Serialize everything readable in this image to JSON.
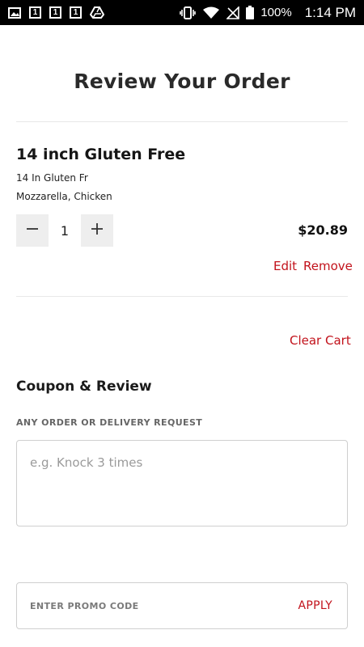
{
  "status_bar": {
    "icons": [
      "image-icon",
      "sim-1-icon",
      "sim-1-icon",
      "sim-1-icon",
      "drive-icon",
      "vibrate-icon",
      "wifi-icon",
      "no-signal-icon",
      "battery-icon"
    ],
    "sim_label": "1",
    "battery": "100%",
    "time": "1:14 PM"
  },
  "page": {
    "title": "Review Your Order"
  },
  "cart_item": {
    "name": "14 inch Gluten Free",
    "size_line": "14 In Gluten Fr",
    "toppings_line": "Mozzarella, Chicken",
    "quantity": "1",
    "price": "$20.89",
    "edit_label": "Edit",
    "remove_label": "Remove",
    "minus_icon": "minus-icon",
    "plus_icon": "plus-icon"
  },
  "clear_cart_label": "Clear Cart",
  "coupon_section": {
    "title": "Coupon & Review",
    "request_label": "ANY ORDER OR DELIVERY REQUEST",
    "request_value": "",
    "request_placeholder": "e.g. Knock 3 times",
    "promo_value": "",
    "promo_placeholder": "ENTER PROMO CODE",
    "apply_label": "APPLY"
  },
  "colors": {
    "accent_red": "#c2121b",
    "qty_button_bg": "#eeeeee",
    "status_bar_bg": "#000000"
  }
}
